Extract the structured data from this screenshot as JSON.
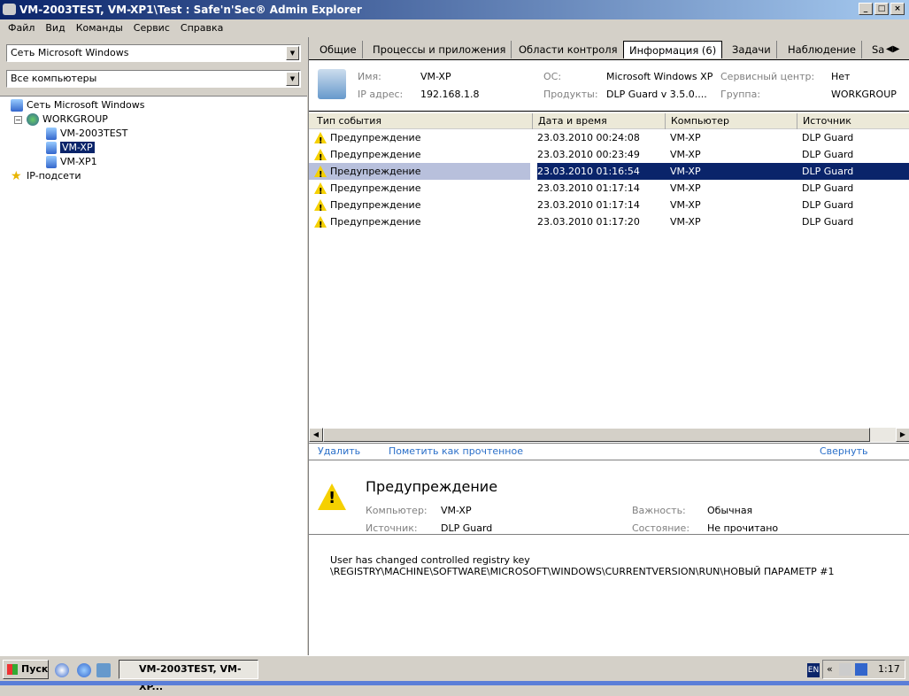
{
  "window": {
    "title": "VM-2003TEST, VM-XP1\\Test : Safe'n'Sec® Admin Explorer"
  },
  "menu": [
    "Файл",
    "Вид",
    "Команды",
    "Сервис",
    "Справка"
  ],
  "left": {
    "combo1": "Сеть Microsoft Windows",
    "combo2": "Все компьютеры",
    "tree": {
      "root": "Сеть Microsoft Windows",
      "group": "WORKGROUP",
      "computers": [
        "VM-2003TEST",
        "VM-XP",
        "VM-XP1"
      ],
      "subnets": "IP-подсети"
    }
  },
  "tabs": [
    "Общие",
    "Процессы и приложения",
    "Области контроля",
    "Информация (6)",
    "Задачи",
    "Наблюдение",
    "Sa"
  ],
  "info": {
    "name_label": "Имя:",
    "name": "VM-XP",
    "ip_label": "IP адрес:",
    "ip": "192.168.1.8",
    "os_label": "ОС:",
    "os": "Microsoft Windows XP",
    "products_label": "Продукты:",
    "products": "DLP Guard v 3.5.0....",
    "service_label": "Сервисный центр:",
    "service": "Нет",
    "group_label": "Группа:",
    "group": "WORKGROUP"
  },
  "table": {
    "headers": [
      "Тип события",
      "Дата и время",
      "Компьютер",
      "Источник"
    ],
    "rows": [
      [
        "Предупреждение",
        "23.03.2010 00:24:08",
        "VM-XP",
        "DLP Guard"
      ],
      [
        "Предупреждение",
        "23.03.2010 00:23:49",
        "VM-XP",
        "DLP Guard"
      ],
      [
        "Предупреждение",
        "23.03.2010 01:16:54",
        "VM-XP",
        "DLP Guard"
      ],
      [
        "Предупреждение",
        "23.03.2010 01:17:14",
        "VM-XP",
        "DLP Guard"
      ],
      [
        "Предупреждение",
        "23.03.2010 01:17:14",
        "VM-XP",
        "DLP Guard"
      ],
      [
        "Предупреждение",
        "23.03.2010 01:17:20",
        "VM-XP",
        "DLP Guard"
      ]
    ]
  },
  "actions": {
    "delete": "Удалить",
    "mark_read": "Пометить как прочтенное",
    "collapse": "Свернуть"
  },
  "detail": {
    "title": "Предупреждение",
    "computer_label": "Компьютер:",
    "computer": "VM-XP",
    "source_label": "Источник:",
    "source": "DLP Guard",
    "importance_label": "Важность:",
    "importance": "Обычная",
    "state_label": "Состояние:",
    "state": "Не прочитано",
    "message1": "User has changed controlled registry key",
    "message2": "\\REGISTRY\\MACHINE\\SOFTWARE\\MICROSOFT\\WINDOWS\\CURRENTVERSION\\RUN\\НОВЫЙ ПАРАМЕТР #1"
  },
  "taskbar": {
    "start": "Пуск",
    "item": "VM-2003TEST, VM-XP...",
    "lang": "EN",
    "tray_chevron": "«",
    "clock": "1:17"
  }
}
